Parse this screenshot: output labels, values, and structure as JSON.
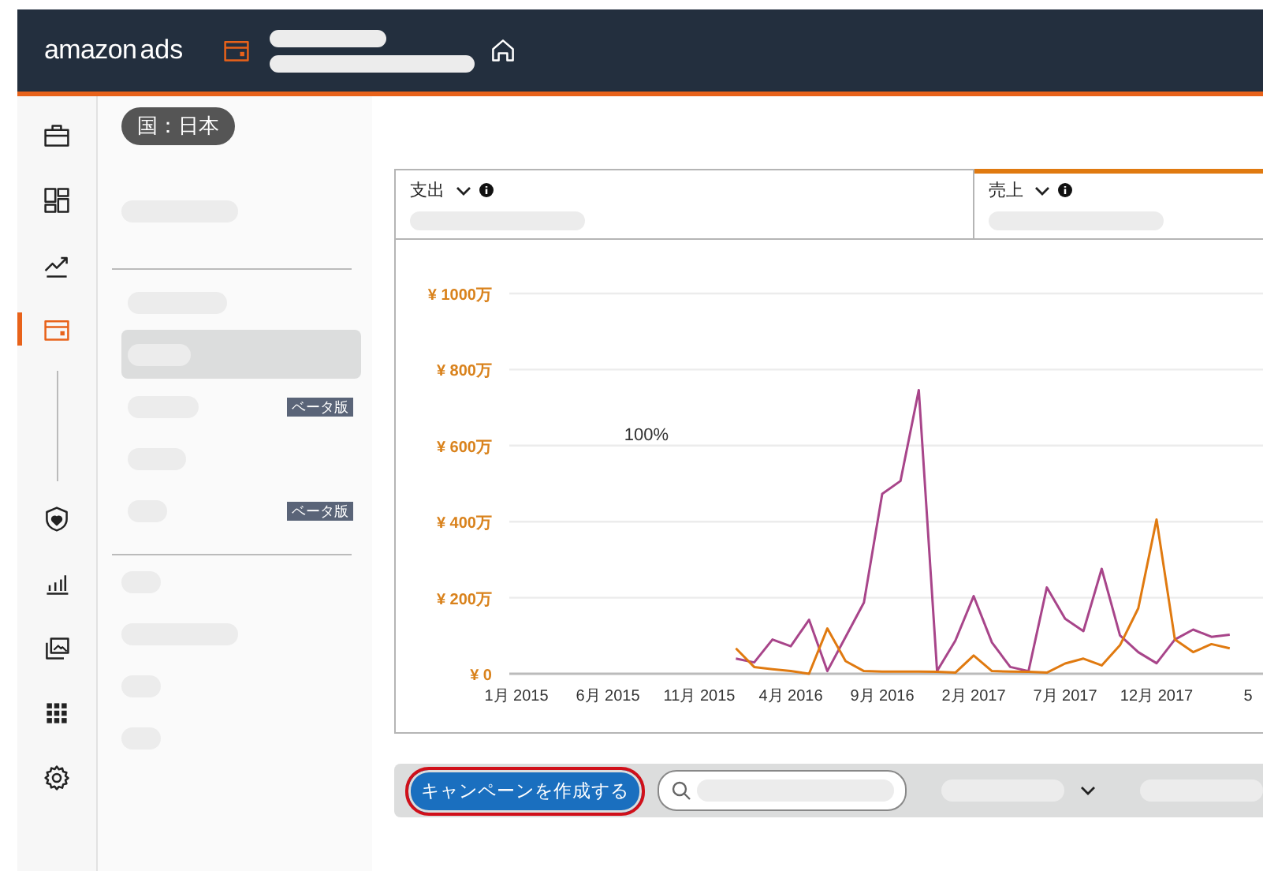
{
  "header": {
    "logo": {
      "word_1": "amazon",
      "word_2": "ads"
    }
  },
  "rail": {
    "top": [
      {
        "kind": "briefcase",
        "selected": false
      },
      {
        "kind": "dashboard",
        "selected": false
      },
      {
        "kind": "trend",
        "selected": false
      },
      {
        "kind": "wallet",
        "selected": true
      }
    ],
    "bottom": [
      {
        "kind": "shield",
        "selected": false
      },
      {
        "kind": "bars",
        "selected": false
      },
      {
        "kind": "media",
        "selected": false
      },
      {
        "kind": "apps",
        "selected": false
      },
      {
        "kind": "gear",
        "selected": false
      }
    ]
  },
  "subnav": {
    "country_chip": "国：日本",
    "groups": [
      {
        "items": [
          {
            "selected": false
          }
        ]
      },
      {
        "items": [
          {
            "selected": false
          },
          {
            "selected": true
          },
          {
            "selected": false,
            "badge": "ベータ版"
          },
          {
            "selected": false
          },
          {
            "selected": false,
            "badge": "ベータ版"
          }
        ]
      },
      {
        "items": [
          {
            "selected": false
          },
          {
            "selected": false
          },
          {
            "selected": false
          },
          {
            "selected": false
          }
        ]
      }
    ]
  },
  "metrics": [
    {
      "label": "支出",
      "selected": false
    },
    {
      "label": "売上",
      "selected": true
    }
  ],
  "chart": {
    "chart_data": {
      "type": "line",
      "categories": [
        "1月 2015",
        null,
        null,
        null,
        null,
        "6月 2015",
        null,
        null,
        null,
        null,
        "11月 2015",
        null,
        null,
        null,
        null,
        "4月 2016",
        null,
        null,
        null,
        null,
        "9月 2016",
        null,
        null,
        null,
        null,
        "2月 2017",
        null,
        null,
        null,
        null,
        "7月 2017",
        null,
        null,
        null,
        null,
        "12月 2017",
        null,
        null,
        null,
        null,
        "5"
      ],
      "series": [
        {
          "color": "#a8458a",
          "values": [
            null,
            null,
            null,
            null,
            null,
            null,
            null,
            null,
            null,
            null,
            null,
            null,
            40,
            30,
            90,
            72,
            142,
            7,
            97,
            187,
            473,
            507,
            746,
            7,
            87,
            204,
            82,
            18,
            7,
            227,
            145,
            112,
            276,
            101,
            57,
            28,
            90,
            116,
            97,
            103,
            null
          ]
        },
        {
          "color": "#e07a10",
          "values": [
            null,
            null,
            null,
            null,
            null,
            null,
            null,
            null,
            null,
            null,
            null,
            null,
            67,
            18,
            12,
            7,
            0,
            119,
            33,
            7,
            6,
            6,
            6,
            5,
            3,
            48,
            7,
            6,
            5,
            3,
            27,
            40,
            22,
            75,
            172,
            406,
            90,
            57,
            78,
            67,
            null
          ]
        }
      ],
      "yticks": [
        {
          "value": 0,
          "label": "¥ 0"
        },
        {
          "value": 200,
          "label": "¥ 200万"
        },
        {
          "value": 400,
          "label": "¥ 400万"
        },
        {
          "value": 600,
          "label": "¥ 600万"
        },
        {
          "value": 800,
          "label": "¥ 800万"
        },
        {
          "value": 1000,
          "label": "¥ 1000万"
        }
      ],
      "ylim": [
        0,
        1000
      ],
      "grid": true,
      "annotations": [
        "100%"
      ]
    }
  },
  "toolbar": {
    "create_button": {
      "label": "キャンペーンを作成する",
      "highlighted": true
    }
  }
}
